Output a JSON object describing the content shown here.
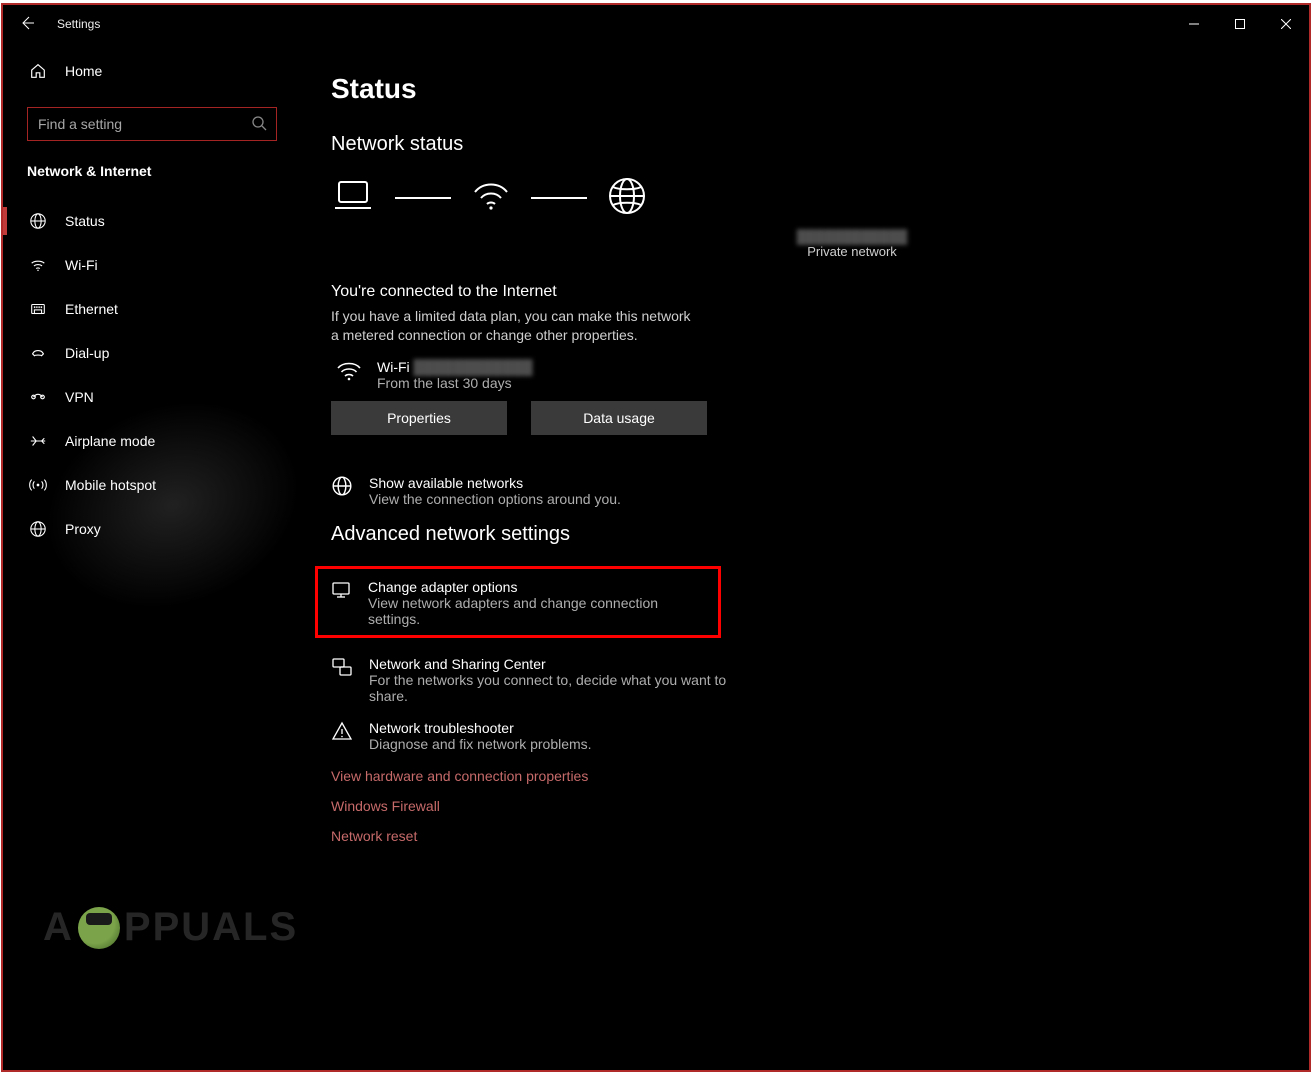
{
  "titlebar": {
    "title": "Settings"
  },
  "sidebar": {
    "home_label": "Home",
    "search_placeholder": "Find a setting",
    "category_label": "Network & Internet",
    "items": [
      {
        "label": "Status"
      },
      {
        "label": "Wi-Fi"
      },
      {
        "label": "Ethernet"
      },
      {
        "label": "Dial-up"
      },
      {
        "label": "VPN"
      },
      {
        "label": "Airplane mode"
      },
      {
        "label": "Mobile hotspot"
      },
      {
        "label": "Proxy"
      }
    ]
  },
  "content": {
    "page_title": "Status",
    "network_status_heading": "Network status",
    "diagram_network_name": "████████████",
    "diagram_network_type": "Private network",
    "connected_title": "You're connected to the Internet",
    "connected_desc": "If you have a limited data plan, you can make this network a metered connection or change other properties.",
    "wifi_label": "Wi-Fi",
    "wifi_ssid": "████████████",
    "wifi_sub": "From the last 30 days",
    "properties_btn": "Properties",
    "data_usage_btn": "Data usage",
    "show_available_title": "Show available networks",
    "show_available_desc": "View the connection options around you.",
    "advanced_heading": "Advanced network settings",
    "change_adapter_title": "Change adapter options",
    "change_adapter_desc": "View network adapters and change connection settings.",
    "sharing_title": "Network and Sharing Center",
    "sharing_desc": "For the networks you connect to, decide what you want to share.",
    "troubleshoot_title": "Network troubleshooter",
    "troubleshoot_desc": "Diagnose and fix network problems.",
    "link_hardware": "View hardware and connection properties",
    "link_firewall": "Windows Firewall",
    "link_reset": "Network reset"
  },
  "watermark": {
    "text": "PPUALS"
  }
}
